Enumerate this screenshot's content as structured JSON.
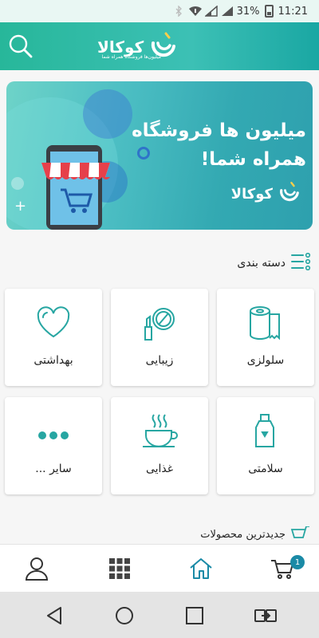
{
  "status_bar": {
    "battery_percent": "31%",
    "time": "11:21"
  },
  "header": {
    "logo_text": "کوکالا",
    "logo_tagline": "میلیون‌ها فروشگاه همراه شما"
  },
  "banner": {
    "title_line1": "میلیون ها فروشگاه",
    "title_line2": "همراه شما!",
    "logo_text": "کوکالا"
  },
  "categories": {
    "heading": "دسته بندی",
    "items": [
      {
        "label": "سلولزی",
        "icon": "tissue-roll-icon"
      },
      {
        "label": "زیبایی",
        "icon": "cosmetics-icon"
      },
      {
        "label": "بهداشتی",
        "icon": "heart-icon"
      },
      {
        "label": "سلامتی",
        "icon": "bottle-icon"
      },
      {
        "label": "غذایی",
        "icon": "coffee-cup-icon"
      },
      {
        "label": "سایر ...",
        "icon": "more-dots-icon"
      }
    ]
  },
  "newest_products": {
    "heading": "جدیدترین محصولات"
  },
  "bottom_nav": {
    "cart_count": "1",
    "items": [
      "cart-icon",
      "home-icon",
      "grid-icon",
      "profile-icon"
    ],
    "active": "home",
    "accent": "#1a8aa6"
  },
  "colors": {
    "brand": "#2cb5a0",
    "icon_teal": "#27a6a2"
  }
}
